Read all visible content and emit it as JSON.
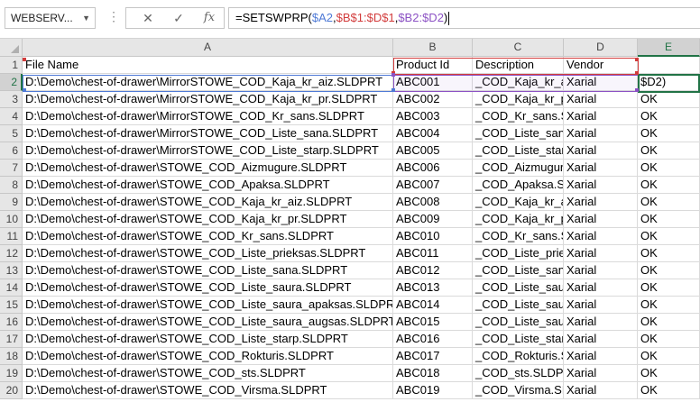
{
  "formula_bar": {
    "name_box": "WEBSERV...",
    "cancel_icon": "close-icon",
    "enter_icon": "check-icon",
    "insert_function_label": "fx",
    "formula_prefix": "=SETSWPRP(",
    "formula_ref_a": "$A2",
    "formula_sep1": ",",
    "formula_ref_b": "$B$1:$D$1",
    "formula_sep2": ",",
    "formula_ref_c": "$B2:$D2",
    "formula_suffix": ")",
    "ref_colors": {
      "a": "#4f7ad6",
      "b": "#d23c3c",
      "c": "#8c52c4",
      "d": "#2e8a3e"
    }
  },
  "grid": {
    "active_cell": "E2",
    "columns": [
      "A",
      "B",
      "C",
      "D",
      "E"
    ],
    "row_numbers": [
      "1",
      "2",
      "3",
      "4",
      "5",
      "6",
      "7",
      "8",
      "9",
      "10",
      "11",
      "12",
      "13",
      "14",
      "15",
      "16",
      "17",
      "18",
      "19",
      "20"
    ],
    "rows": [
      [
        "File Name",
        "Product Id",
        "Description",
        "Vendor",
        ""
      ],
      [
        "D:\\Demo\\chest-of-drawer\\MirrorSTOWE_COD_Kaja_kr_aiz.SLDPRT",
        "ABC001",
        "_COD_Kaja_kr_aiz",
        "Xarial",
        "$D2)"
      ],
      [
        "D:\\Demo\\chest-of-drawer\\MirrorSTOWE_COD_Kaja_kr_pr.SLDPRT",
        "ABC002",
        "_COD_Kaja_kr_pr",
        "Xarial",
        "OK"
      ],
      [
        "D:\\Demo\\chest-of-drawer\\MirrorSTOWE_COD_Kr_sans.SLDPRT",
        "ABC003",
        "_COD_Kr_sans.SLDPRT",
        "Xarial",
        "OK"
      ],
      [
        "D:\\Demo\\chest-of-drawer\\MirrorSTOWE_COD_Liste_sana.SLDPRT",
        "ABC004",
        "_COD_Liste_sana",
        "Xarial",
        "OK"
      ],
      [
        "D:\\Demo\\chest-of-drawer\\MirrorSTOWE_COD_Liste_starp.SLDPRT",
        "ABC005",
        "_COD_Liste_starp",
        "Xarial",
        "OK"
      ],
      [
        "D:\\Demo\\chest-of-drawer\\STOWE_COD_Aizmugure.SLDPRT",
        "ABC006",
        "_COD_Aizmugure",
        "Xarial",
        "OK"
      ],
      [
        "D:\\Demo\\chest-of-drawer\\STOWE_COD_Apaksa.SLDPRT",
        "ABC007",
        "_COD_Apaksa.SLDPRT",
        "Xarial",
        "OK"
      ],
      [
        "D:\\Demo\\chest-of-drawer\\STOWE_COD_Kaja_kr_aiz.SLDPRT",
        "ABC008",
        "_COD_Kaja_kr_aiz",
        "Xarial",
        "OK"
      ],
      [
        "D:\\Demo\\chest-of-drawer\\STOWE_COD_Kaja_kr_pr.SLDPRT",
        "ABC009",
        "_COD_Kaja_kr_pr",
        "Xarial",
        "OK"
      ],
      [
        "D:\\Demo\\chest-of-drawer\\STOWE_COD_Kr_sans.SLDPRT",
        "ABC010",
        "_COD_Kr_sans.SLDPRT",
        "Xarial",
        "OK"
      ],
      [
        "D:\\Demo\\chest-of-drawer\\STOWE_COD_Liste_prieksas.SLDPRT",
        "ABC011",
        "_COD_Liste_prieksas",
        "Xarial",
        "OK"
      ],
      [
        "D:\\Demo\\chest-of-drawer\\STOWE_COD_Liste_sana.SLDPRT",
        "ABC012",
        "_COD_Liste_sana",
        "Xarial",
        "OK"
      ],
      [
        "D:\\Demo\\chest-of-drawer\\STOWE_COD_Liste_saura.SLDPRT",
        "ABC013",
        "_COD_Liste_saura",
        "Xarial",
        "OK"
      ],
      [
        "D:\\Demo\\chest-of-drawer\\STOWE_COD_Liste_saura_apaksas.SLDPRT",
        "ABC014",
        "_COD_Liste_saura",
        "Xarial",
        "OK"
      ],
      [
        "D:\\Demo\\chest-of-drawer\\STOWE_COD_Liste_saura_augsas.SLDPRT",
        "ABC015",
        "_COD_Liste_saura",
        "Xarial",
        "OK"
      ],
      [
        "D:\\Demo\\chest-of-drawer\\STOWE_COD_Liste_starp.SLDPRT",
        "ABC016",
        "_COD_Liste_starp",
        "Xarial",
        "OK"
      ],
      [
        "D:\\Demo\\chest-of-drawer\\STOWE_COD_Rokturis.SLDPRT",
        "ABC017",
        "_COD_Rokturis.SLDPRT",
        "Xarial",
        "OK"
      ],
      [
        "D:\\Demo\\chest-of-drawer\\STOWE_COD_sts.SLDPRT",
        "ABC018",
        "_COD_sts.SLDPRT",
        "Xarial",
        "OK"
      ],
      [
        "D:\\Demo\\chest-of-drawer\\STOWE_COD_Virsma.SLDPRT",
        "ABC019",
        "_COD_Virsma.SLDPRT",
        "Xarial",
        "OK"
      ]
    ]
  }
}
